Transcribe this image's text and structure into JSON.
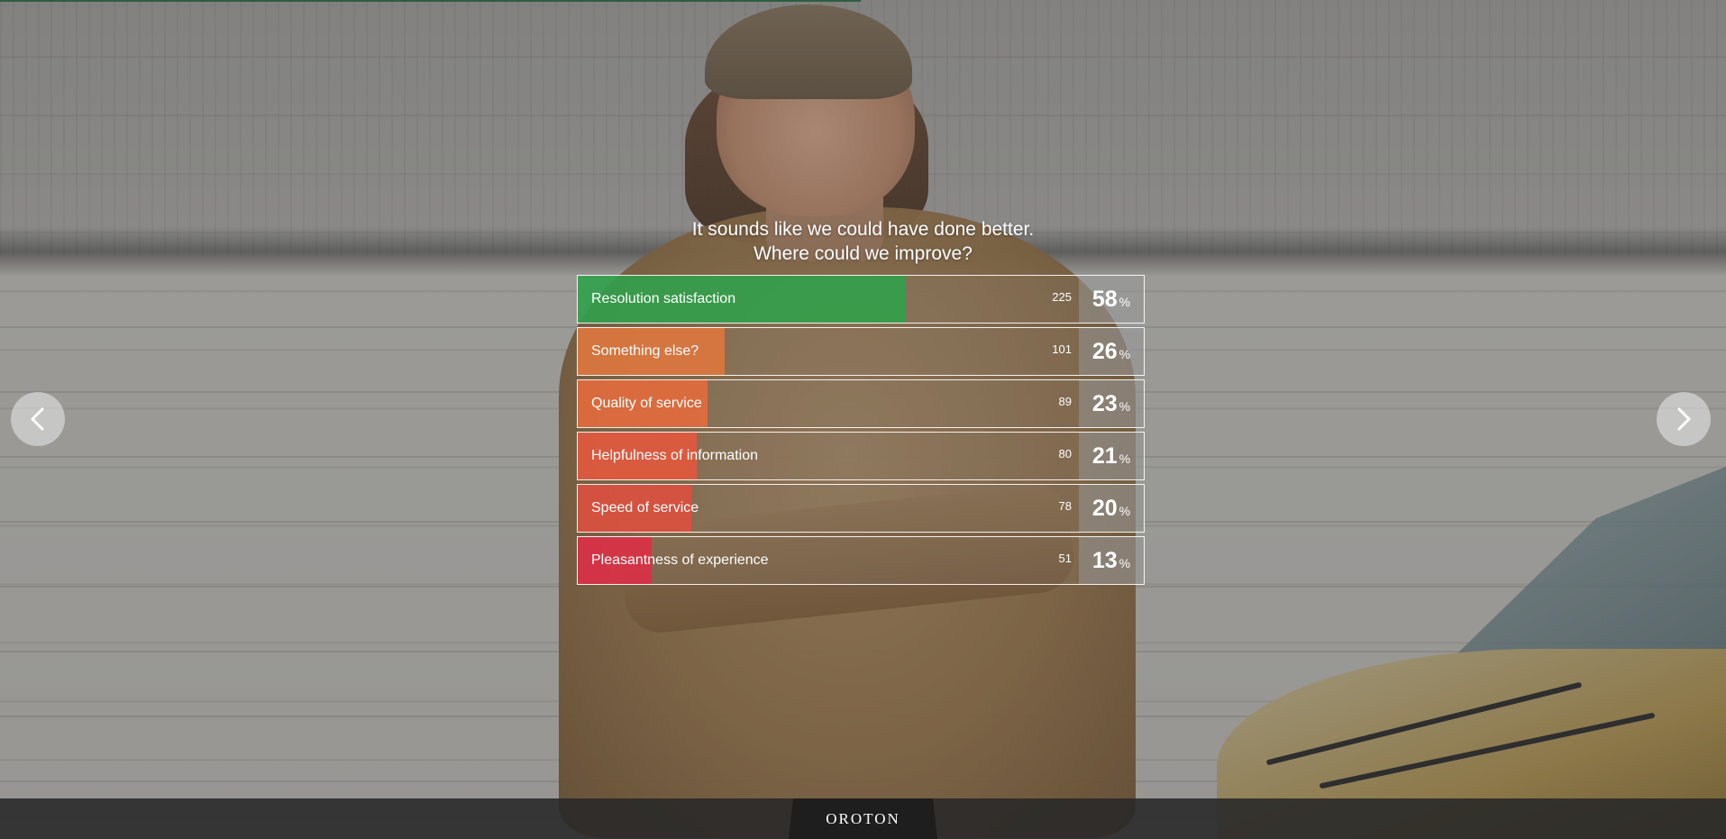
{
  "survey": {
    "question_line1": "It sounds like we could have done better.",
    "question_line2": "Where could we improve?",
    "options": [
      {
        "label": "Resolution satisfaction",
        "count": "225",
        "percent": "58",
        "percent_sign": "%",
        "fill_fraction": 0.58,
        "color": "#2fa14a"
      },
      {
        "label": "Something else?",
        "count": "101",
        "percent": "26",
        "percent_sign": "%",
        "fill_fraction": 0.26,
        "color": "#e0763c"
      },
      {
        "label": "Quality of service",
        "count": "89",
        "percent": "23",
        "percent_sign": "%",
        "fill_fraction": 0.23,
        "color": "#e66b3c"
      },
      {
        "label": "Helpfulness of information",
        "count": "80",
        "percent": "21",
        "percent_sign": "%",
        "fill_fraction": 0.21,
        "color": "#e6583d"
      },
      {
        "label": "Speed of service",
        "count": "78",
        "percent": "20",
        "percent_sign": "%",
        "fill_fraction": 0.2,
        "color": "#df4f3e"
      },
      {
        "label": "Pleasantness of experience",
        "count": "51",
        "percent": "13",
        "percent_sign": "%",
        "fill_fraction": 0.13,
        "color": "#de2e45"
      }
    ]
  },
  "nav": {
    "prev_icon": "chevron-left-icon",
    "next_icon": "chevron-right-icon"
  },
  "footer": {
    "logo_text": "OROTON"
  }
}
